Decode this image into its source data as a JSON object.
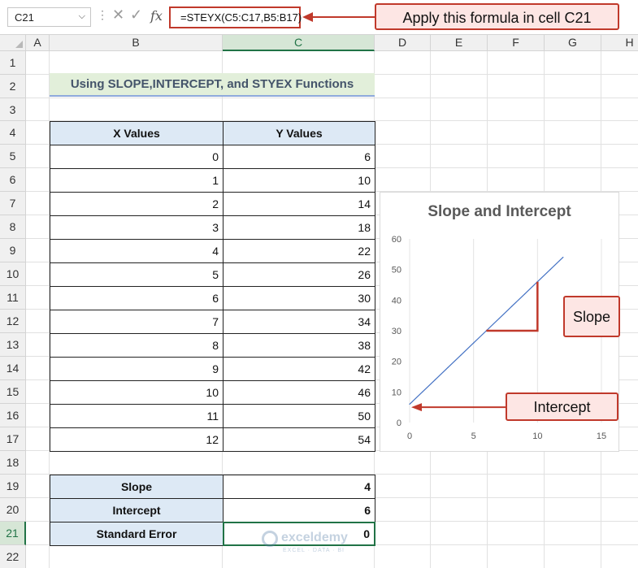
{
  "formula_bar": {
    "name_box": "C21",
    "formula": "=STEYX(C5:C17,B5:B17)",
    "fx_label": "fx",
    "callout": "Apply this formula in cell C21"
  },
  "columns": [
    "A",
    "B",
    "C",
    "D",
    "E",
    "F",
    "G",
    "H"
  ],
  "selected_column": "C",
  "rows": [
    "1",
    "2",
    "3",
    "4",
    "5",
    "6",
    "7",
    "8",
    "9",
    "10",
    "11",
    "12",
    "13",
    "14",
    "15",
    "16",
    "17",
    "18",
    "19",
    "20",
    "21",
    "22"
  ],
  "selected_row": "21",
  "sheet_title": "Using SLOPE,INTERCEPT, and STYEX Functions",
  "table": {
    "headers": [
      "X Values",
      "Y Values"
    ],
    "x_values": [
      "0",
      "1",
      "2",
      "3",
      "4",
      "5",
      "6",
      "7",
      "8",
      "9",
      "10",
      "11",
      "12"
    ],
    "y_values": [
      "6",
      "10",
      "14",
      "18",
      "22",
      "26",
      "30",
      "34",
      "38",
      "42",
      "46",
      "50",
      "54"
    ]
  },
  "results": [
    {
      "label": "Slope",
      "value": "4"
    },
    {
      "label": "Intercept",
      "value": "6"
    },
    {
      "label": "Standard Error",
      "value": "0"
    }
  ],
  "chart_data": {
    "type": "line",
    "title": "Slope and Intercept",
    "x": [
      0,
      1,
      2,
      3,
      4,
      5,
      6,
      7,
      8,
      9,
      10,
      11,
      12
    ],
    "series": [
      {
        "values": [
          6,
          10,
          14,
          18,
          22,
          26,
          30,
          34,
          38,
          42,
          46,
          50,
          54
        ]
      }
    ],
    "xlim": [
      0,
      15
    ],
    "ylim": [
      0,
      60
    ],
    "x_ticks": [
      "0",
      "5",
      "10",
      "15"
    ],
    "y_ticks": [
      "0",
      "10",
      "20",
      "30",
      "40",
      "50",
      "60"
    ],
    "grid": "vertical",
    "line_color": "#4472c4"
  },
  "annotations": {
    "slope": "Slope",
    "intercept": "Intercept",
    "accent_color": "#c0392b"
  },
  "watermark": {
    "name": "exceldemy",
    "tagline": "EXCEL · DATA · BI"
  }
}
